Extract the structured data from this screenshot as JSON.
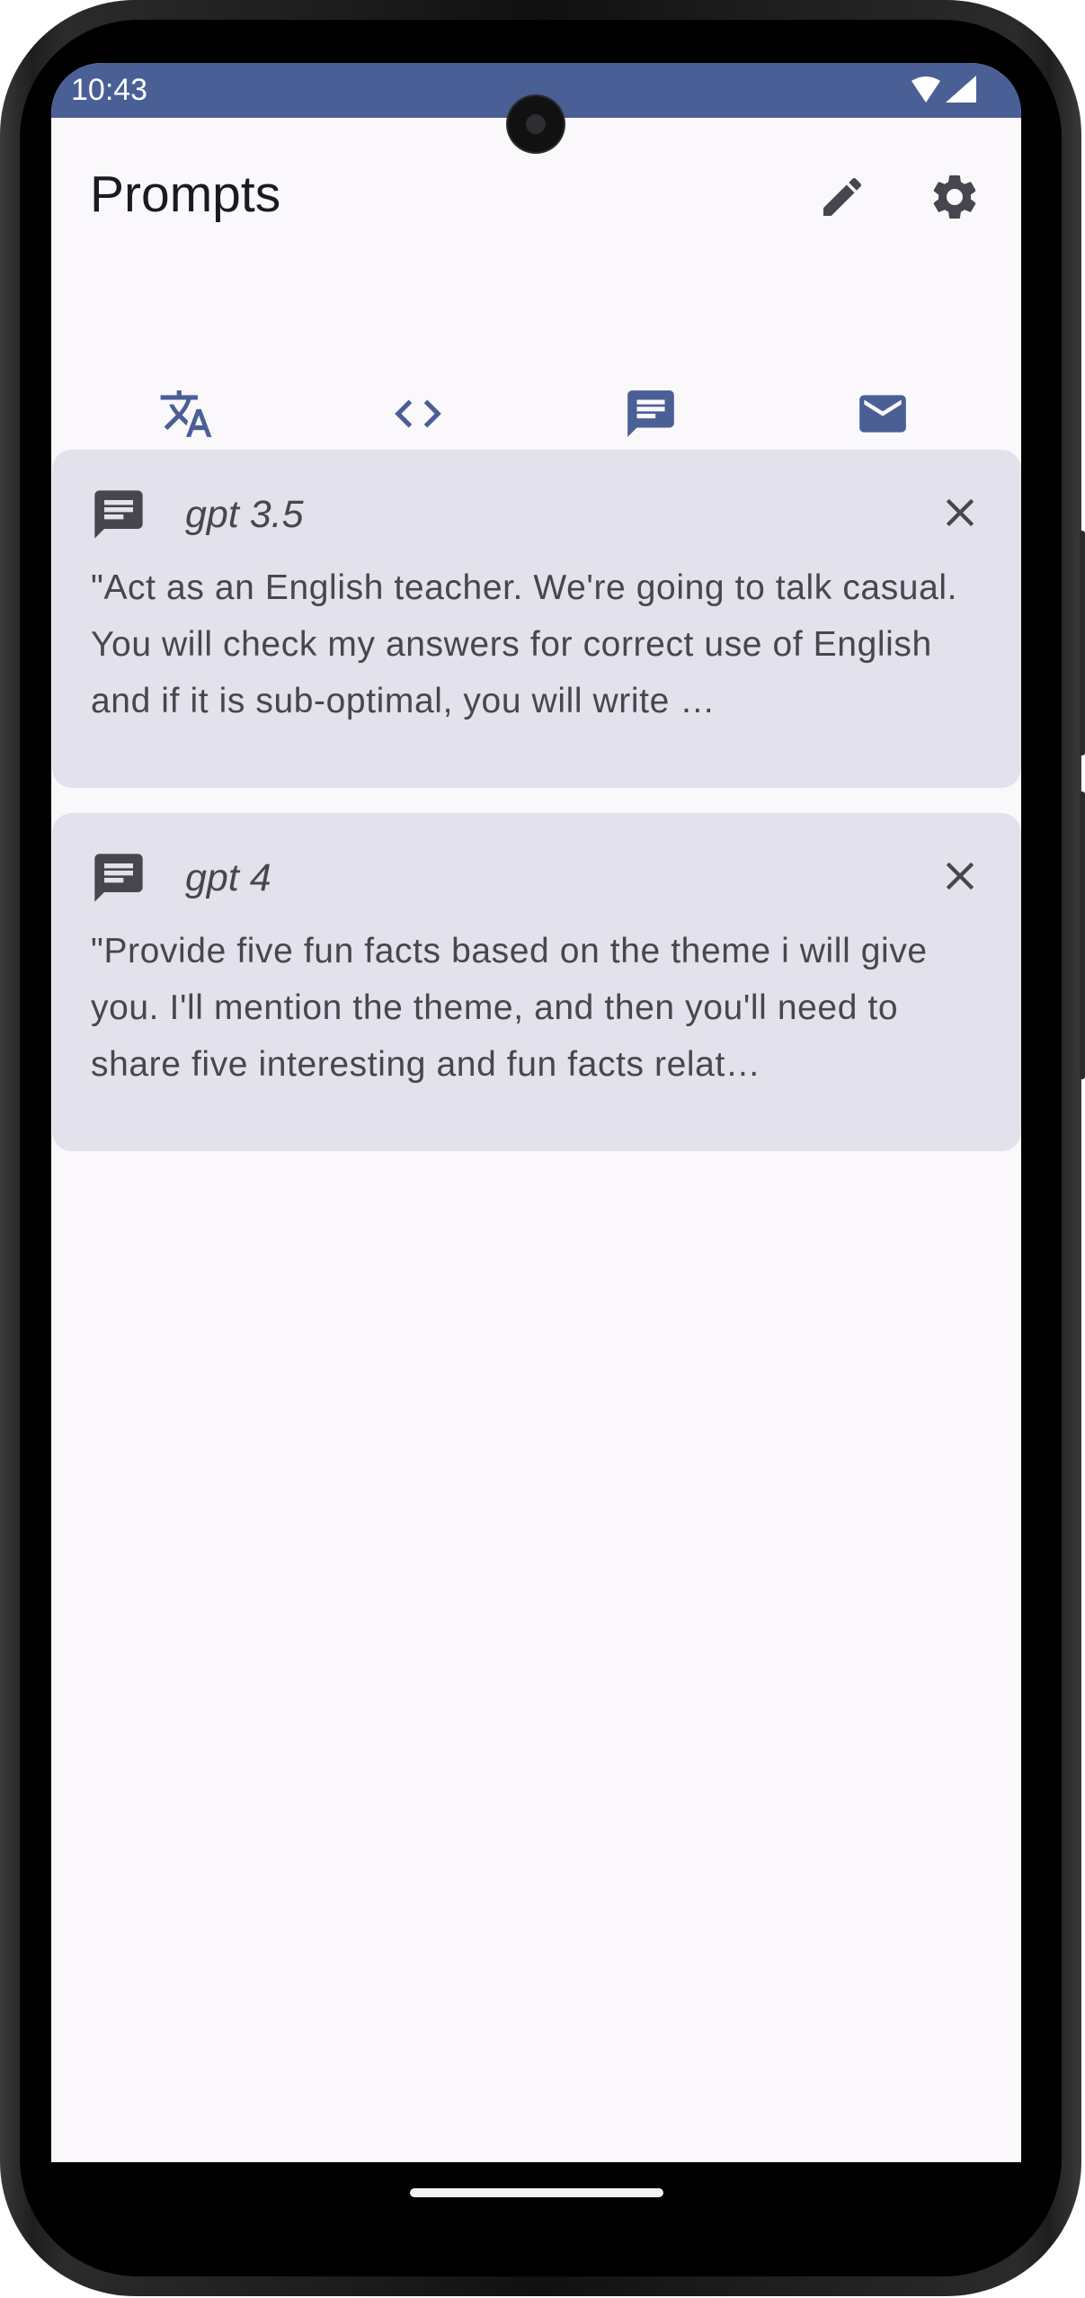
{
  "status_bar": {
    "time": "10:43",
    "background_color": "#4a5f96",
    "icons": [
      "wifi-icon",
      "signal-icon"
    ]
  },
  "app_bar": {
    "title": "Prompts",
    "actions": [
      "edit-icon",
      "settings-icon"
    ]
  },
  "tabs": {
    "items": [
      {
        "icon": "translate-icon",
        "selected": false
      },
      {
        "icon": "code-icon",
        "selected": false
      },
      {
        "icon": "chat-icon",
        "selected": true
      },
      {
        "icon": "mail-icon",
        "selected": false
      }
    ],
    "accent_color": "#4a5f96"
  },
  "prompts": [
    {
      "icon": "chat-icon",
      "model": "gpt 3.5",
      "text": "\"Act as an English teacher. We're going to talk casual. You will check my answers for correct use of English and if it is sub-optimal, you will write …"
    },
    {
      "icon": "chat-icon",
      "model": "gpt 4",
      "text": "\"Provide five fun facts based on the theme i will give you. I'll mention the theme, and then you'll need to share five interesting and fun facts relat…"
    }
  ]
}
